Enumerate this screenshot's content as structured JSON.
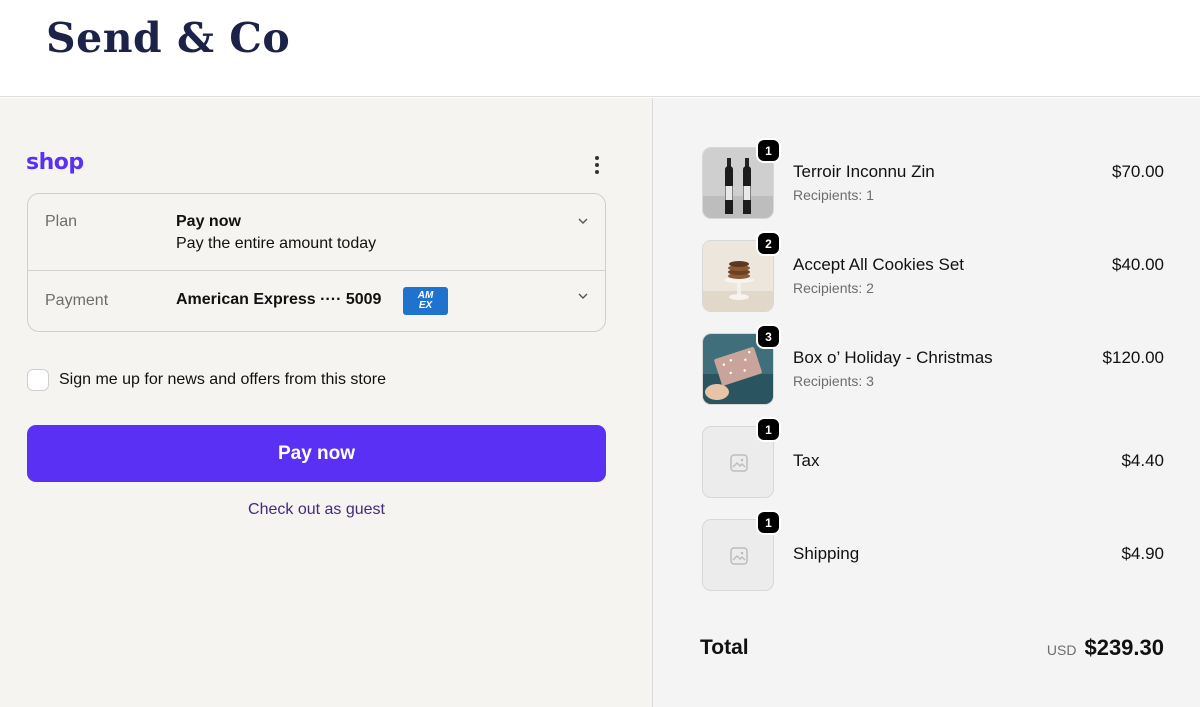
{
  "header": {
    "brand": "Send & Co"
  },
  "shop": {
    "logo": "shop",
    "menu_icon": "kebab-menu-icon"
  },
  "plan": {
    "label": "Plan",
    "title": "Pay now",
    "subtitle": "Pay the entire amount today"
  },
  "payment": {
    "label": "Payment",
    "card_text": "American Express ···· 5009",
    "card_logo_line1": "AM",
    "card_logo_line2": "EX"
  },
  "newsletter": {
    "label": "Sign me up for news and offers from this store",
    "checked": false
  },
  "actions": {
    "pay_label": "Pay now",
    "guest_label": "Check out as guest"
  },
  "colors": {
    "accent": "#5a31f4",
    "brand": "#1d2348",
    "link": "#46297d",
    "amex": "#1f72cd"
  },
  "summary": {
    "items": [
      {
        "qty": "1",
        "name": "Terroir Inconnu Zin",
        "sub": "Recipients: 1",
        "price": "$70.00",
        "image": "wine-bottles"
      },
      {
        "qty": "2",
        "name": "Accept All Cookies Set",
        "sub": "Recipients: 2",
        "price": "$40.00",
        "image": "cookies-stack"
      },
      {
        "qty": "3",
        "name": "Box o’ Holiday - Christmas",
        "sub": "Recipients: 3",
        "price": "$120.00",
        "image": "holiday-card"
      },
      {
        "qty": "1",
        "name": "Tax",
        "sub": "",
        "price": "$4.40",
        "image": "placeholder-image-icon"
      },
      {
        "qty": "1",
        "name": "Shipping",
        "sub": "",
        "price": "$4.90",
        "image": "placeholder-image-icon"
      }
    ],
    "total_label": "Total",
    "currency": "USD",
    "total_amount": "$239.30"
  }
}
